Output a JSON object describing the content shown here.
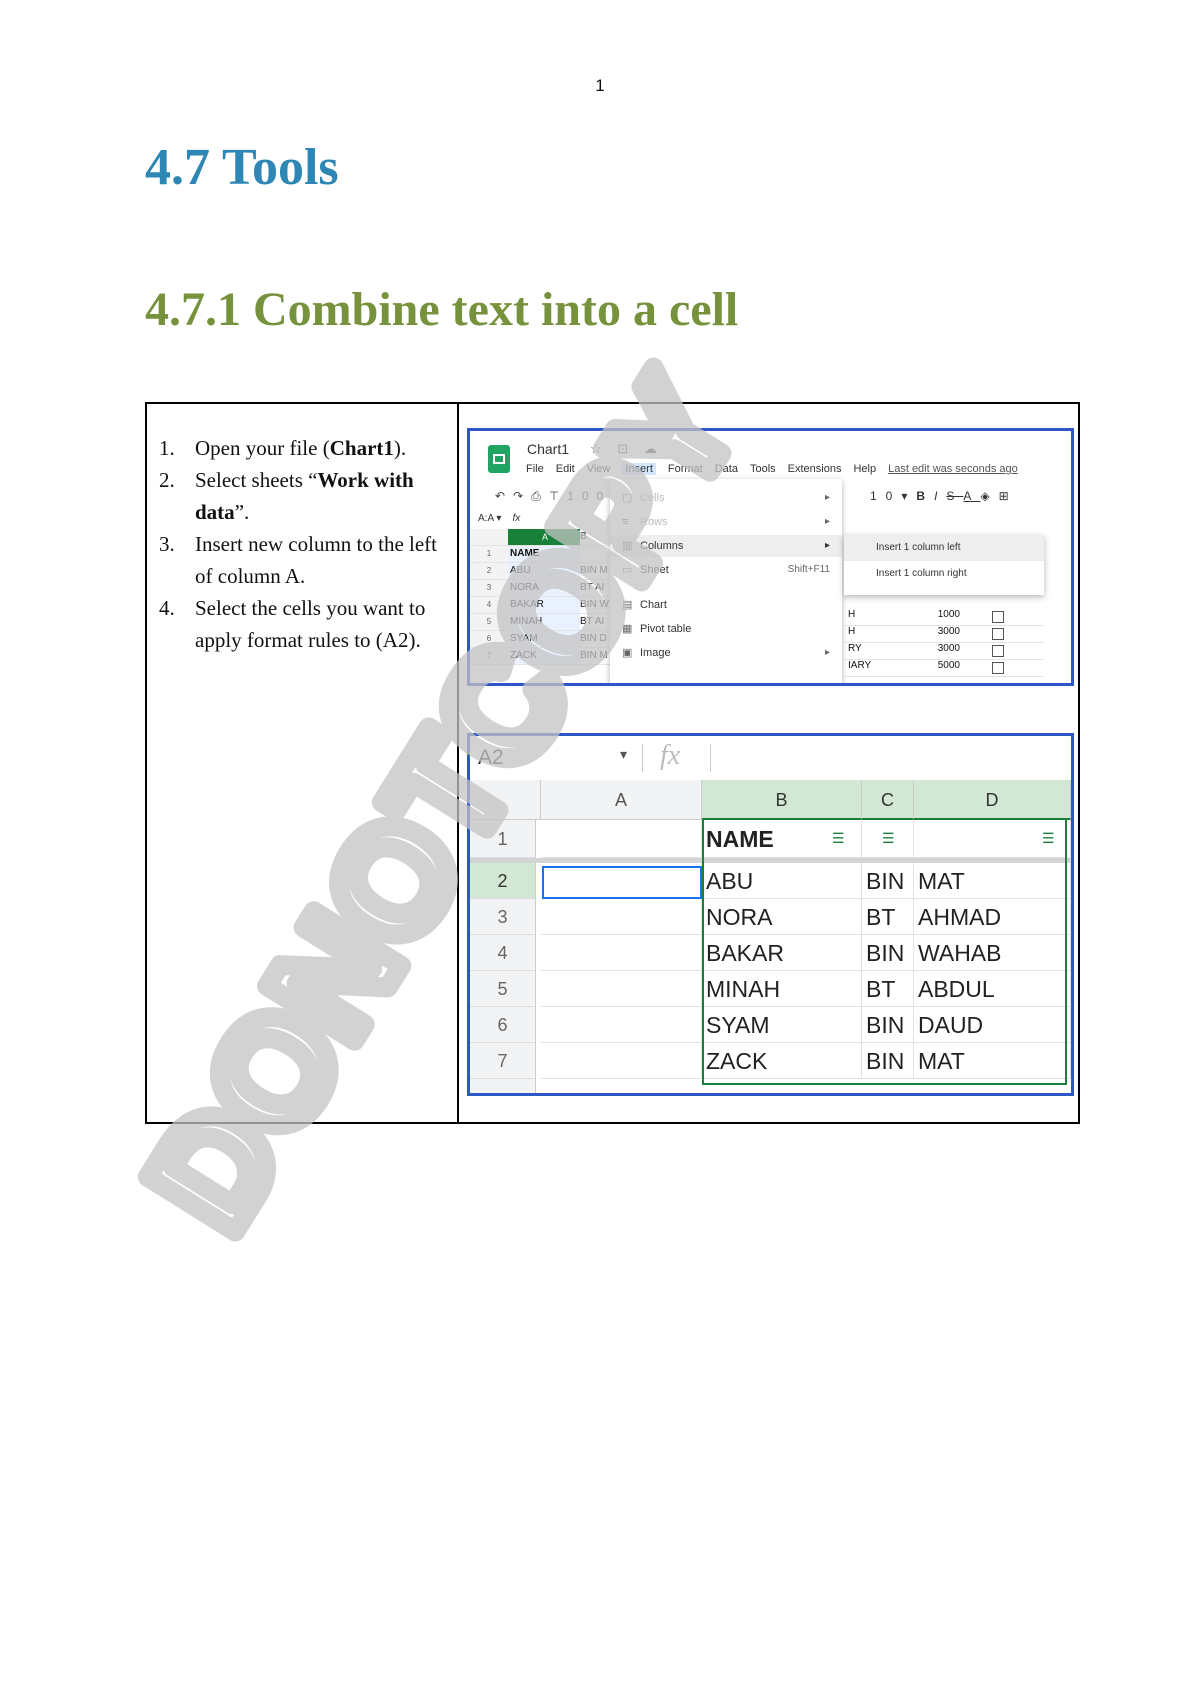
{
  "page_number": "1",
  "heading1": "4.7 Tools",
  "heading2": "4.7.1 Combine text into a cell",
  "steps": [
    {
      "num": "1.",
      "parts": [
        "Open your file (",
        "Chart1",
        ")."
      ]
    },
    {
      "num": "2.",
      "parts": [
        "Select sheets “",
        "Work with data",
        "”."
      ]
    },
    {
      "num": "3.",
      "parts": [
        "Insert new column to the left of column A.",
        "",
        ""
      ]
    },
    {
      "num": "4.",
      "parts": [
        "Select the cells you want to apply format rules to (A2).",
        "",
        ""
      ]
    }
  ],
  "watermark": "DONOTCOPY",
  "shot1": {
    "doc_title": "Chart1",
    "menu": [
      "File",
      "Edit",
      "View",
      "Insert",
      "Format",
      "Data",
      "Tools",
      "Extensions",
      "Help"
    ],
    "last_edit": "Last edit was seconds ago",
    "zoom": "100",
    "font_size": "10",
    "namebox": "A:A",
    "col_a_header": "A",
    "col_b_header": "B",
    "b1": "NAME",
    "rows": [
      {
        "n": "1",
        "a": "NAME",
        "b": ""
      },
      {
        "n": "2",
        "a": "ABU",
        "b": "BIN M"
      },
      {
        "n": "3",
        "a": "NORA",
        "b": "BT AI"
      },
      {
        "n": "4",
        "a": "BAKAR",
        "b": "BIN W"
      },
      {
        "n": "5",
        "a": "MINAH",
        "b": "BT AI"
      },
      {
        "n": "6",
        "a": "SYAM",
        "b": "BIN D"
      },
      {
        "n": "7",
        "a": "ZACK",
        "b": "BIN M"
      }
    ],
    "insert_menu": [
      {
        "icon": "▢",
        "label": "Cells",
        "shortcut": "▸",
        "disabled": true
      },
      {
        "icon": "≡",
        "label": "Rows",
        "shortcut": "▸",
        "disabled": true
      },
      {
        "icon": "▥",
        "label": "Columns",
        "shortcut": "▸",
        "disabled": false
      },
      {
        "icon": "▭",
        "label": "Sheet",
        "shortcut": "Shift+F11",
        "disabled": false
      },
      {
        "icon": "▤",
        "label": "Chart",
        "shortcut": "",
        "disabled": false
      },
      {
        "icon": "▦",
        "label": "Pivot table",
        "shortcut": "",
        "disabled": false
      },
      {
        "icon": "▣",
        "label": "Image",
        "shortcut": "▸",
        "disabled": false
      }
    ],
    "submenu": [
      "Insert 1 column left",
      "Insert 1 column right"
    ],
    "right_rows": [
      {
        "c1": "H",
        "c2": "1000"
      },
      {
        "c1": "H",
        "c2": "3000"
      },
      {
        "c1": "RY",
        "c2": "3000"
      },
      {
        "c1": "IARY",
        "c2": "5000"
      }
    ]
  },
  "shot2": {
    "cell_ref": "A2",
    "fx": "fx",
    "col_headers": [
      "A",
      "B",
      "C",
      "D"
    ],
    "rows": [
      {
        "n": "1",
        "a": "",
        "b": "NAME",
        "c": "",
        "d": ""
      },
      {
        "n": "2",
        "a": "",
        "b": "ABU",
        "c": "BIN",
        "d": "MAT"
      },
      {
        "n": "3",
        "a": "",
        "b": "NORA",
        "c": "BT",
        "d": "AHMAD"
      },
      {
        "n": "4",
        "a": "",
        "b": "BAKAR",
        "c": "BIN",
        "d": "WAHAB"
      },
      {
        "n": "5",
        "a": "",
        "b": "MINAH",
        "c": "BT",
        "d": "ABDUL"
      },
      {
        "n": "6",
        "a": "",
        "b": "SYAM",
        "c": "BIN",
        "d": "DAUD"
      },
      {
        "n": "7",
        "a": "",
        "b": "ZACK",
        "c": "BIN",
        "d": "MAT"
      }
    ]
  }
}
